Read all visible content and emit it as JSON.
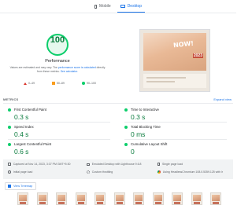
{
  "tabs": [
    {
      "label": "Mobile",
      "icon": "phone-icon",
      "active": false
    },
    {
      "label": "Desktop",
      "icon": "monitor-icon",
      "active": true
    }
  ],
  "performance": {
    "score": "100",
    "label": "Performance",
    "note_prefix": "Values are estimated and may vary. The ",
    "note_link": "performance score is calculated",
    "note_suffix": " directly from these metrics. ",
    "note_link2": "See calculator.",
    "score_color": "#0cce6b"
  },
  "legend": [
    {
      "shape": "triangle",
      "label": "0–49",
      "color": "#d93025"
    },
    {
      "shape": "square",
      "label": "50–89",
      "color": "#fa9d1c"
    },
    {
      "shape": "circle",
      "label": "90–100",
      "color": "#0cce6b"
    }
  ],
  "screenshot": {
    "headline": "NOW!",
    "badge": "2023"
  },
  "metrics": {
    "title": "METRICS",
    "expand_label": "Expand view",
    "items": [
      {
        "name": "First Contentful Paint",
        "value": "0.3 s"
      },
      {
        "name": "Time to Interactive",
        "value": "0.3 s"
      },
      {
        "name": "Speed Index",
        "value": "0.4 s"
      },
      {
        "name": "Total Blocking Time",
        "value": "0 ms"
      },
      {
        "name": "Largest Contentful Paint",
        "value": "0.6 s"
      },
      {
        "name": "Cumulative Layout Shift",
        "value": "0"
      }
    ]
  },
  "info": {
    "captured": "Captured at Nov 14, 2023, 3:37 PM GMT+5:30",
    "emulated": "Emulated Desktop with Lighthouse 9.6.8",
    "session": "Single page load",
    "initial": "Initial page load",
    "throttling": "Custom throttling",
    "browser": "Using HeadlessChromium 108.0.5359.125 with lr"
  },
  "treemap": {
    "label": "View Treemap"
  },
  "filmstrip_count": 11
}
